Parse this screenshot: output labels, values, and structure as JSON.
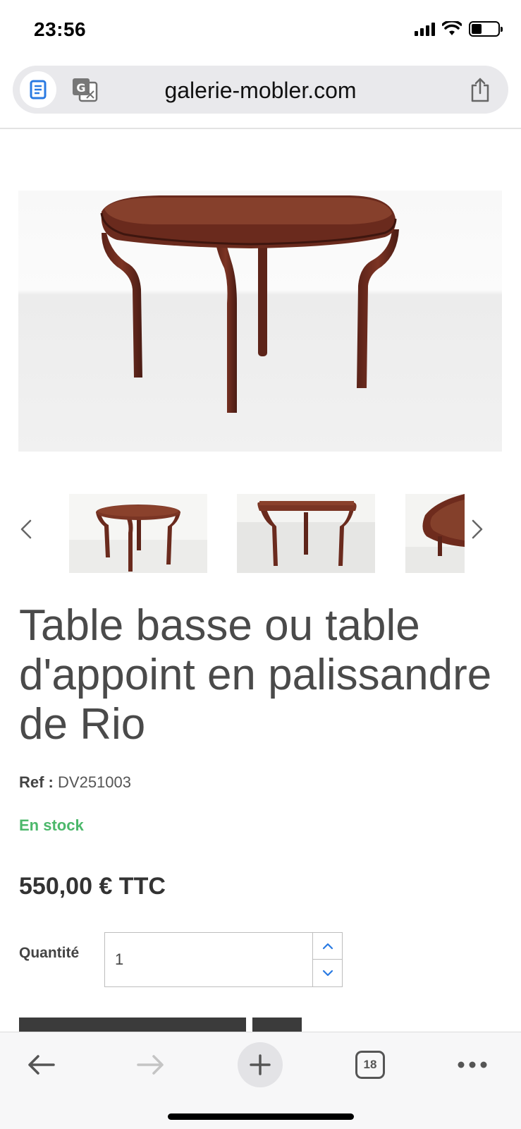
{
  "status_bar": {
    "time": "23:56"
  },
  "browser": {
    "url": "galerie-mobler.com",
    "reader_icon": "reader-icon",
    "translate_icon": "translate-icon",
    "share_icon": "share-icon"
  },
  "gallery": {
    "main_image": "rosewood-side-table-photo",
    "thumbnails": [
      "thumbnail-1",
      "thumbnail-2",
      "thumbnail-3"
    ]
  },
  "product": {
    "title": "Table basse ou table d'appoint en palissandre de Rio",
    "ref_label": "Ref :",
    "ref_value": "DV251003",
    "stock": "En stock",
    "price": "550,00 € TTC",
    "quantity_label": "Quantité",
    "quantity_value": "1"
  },
  "toolbar": {
    "tabs_count": "18"
  },
  "colors": {
    "stock_green": "#4cb86b",
    "accent_blue": "#2a7ae2",
    "wood": "#6b2a1c"
  }
}
